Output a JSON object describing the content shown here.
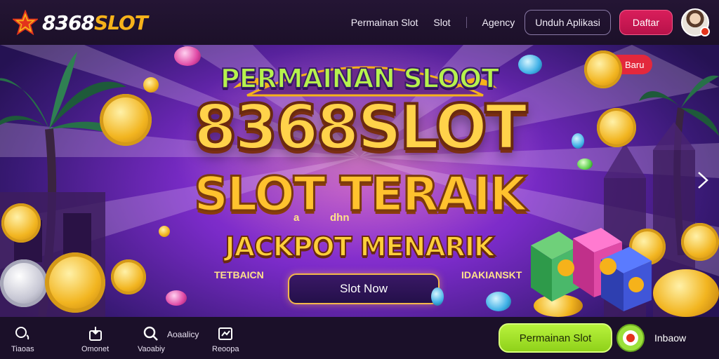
{
  "header": {
    "logo_prefix": "8368",
    "logo_suffix": "SLOT",
    "nav": [
      "Permainan Slot",
      "Slot",
      "Agency"
    ],
    "outline_button": "Unduh Aplikasi",
    "primary_button": "Daftar"
  },
  "hero": {
    "banner_small": "PERMAINAN SLOOT",
    "title_big": "8368SLOT",
    "title_mid": "SLOT TERAIK",
    "small_a": "a",
    "small_dhn": "dhn",
    "title_jackpot": "JACKPOT MENARIK",
    "side_left": "TETBAICN",
    "side_right": "IDAKIANSKT",
    "cta": "Slot Now",
    "badge": "Baru"
  },
  "bottom": {
    "items": [
      {
        "label": "Tiaoas",
        "icon": "home-icon"
      },
      {
        "label": "Omonet",
        "icon": "deposit-icon"
      },
      {
        "label": "Vaoabiy",
        "icon": "search-icon"
      },
      {
        "label": "Aoaalicy",
        "icon": "info-text"
      },
      {
        "label": "Reoopa",
        "icon": "promo-icon"
      }
    ],
    "green_button": "Permainan Slot",
    "chat_label": "Inbaow"
  },
  "colors": {
    "brand_gold": "#f6b21a",
    "primary_pink": "#d91e5b",
    "cta_green": "#b8f23c",
    "hero_purple": "#7a2bc8"
  }
}
